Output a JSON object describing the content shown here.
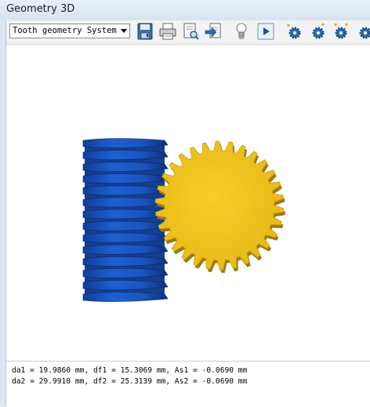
{
  "window": {
    "title": "Geometry 3D"
  },
  "toolbar": {
    "view_select": {
      "selected": "Tooth geometry System"
    },
    "buttons": [
      {
        "name": "save-icon"
      },
      {
        "name": "print-icon"
      },
      {
        "name": "print-preview-icon"
      },
      {
        "name": "export-icon"
      },
      {
        "name": "lighting-icon"
      },
      {
        "name": "play-icon"
      },
      {
        "name": "gear-settings-icon"
      },
      {
        "name": "gear-settings-icon"
      },
      {
        "name": "gear-settings-icon"
      },
      {
        "name": "gear-settings-icon"
      }
    ]
  },
  "model": {
    "worm_color": "#1a55c4",
    "wheel_color": "#f2c51e"
  },
  "results": {
    "line1": "da1 = 19.9860 mm,  df1 = 15.3069 mm,  As1 = -0.0690 mm",
    "line2": "da2 = 29.9910 mm,  df2 = 25.3139 mm,  As2 = -0.0690 mm"
  }
}
